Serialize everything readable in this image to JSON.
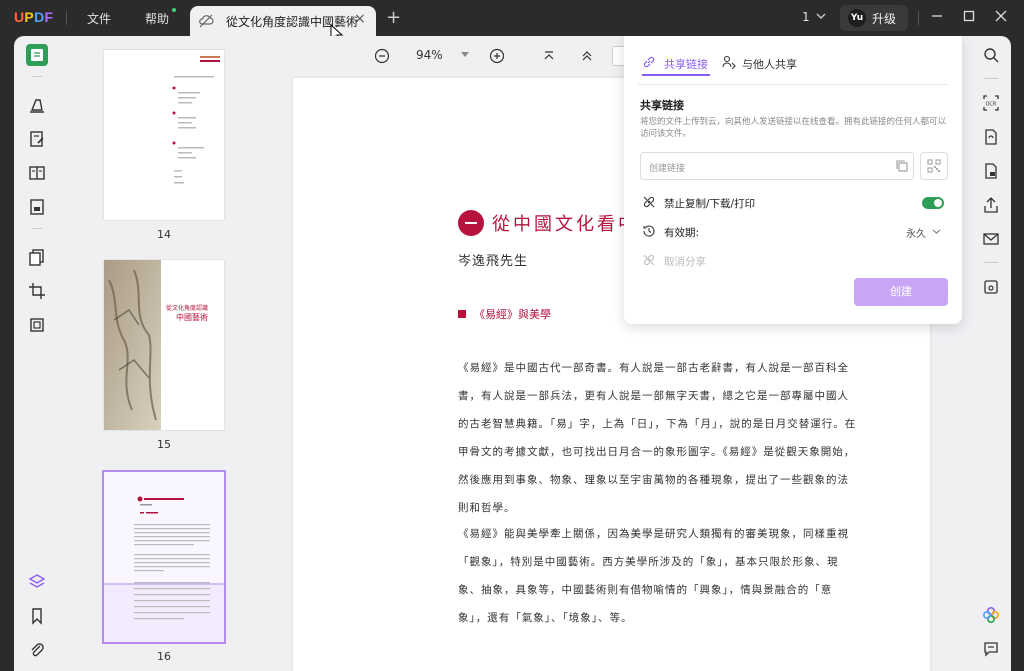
{
  "app": {
    "logo": "UPDF",
    "menu": {
      "file": "文件",
      "help": "帮助"
    },
    "tab": {
      "label": "從文化角度認識中國藝術"
    },
    "page_indicator": "1",
    "user_initials": "Yu",
    "upgrade_label": "升级"
  },
  "toolbar": {
    "zoom": "94%"
  },
  "thumbnails": [
    {
      "page": "14"
    },
    {
      "page": "15",
      "title_line1": "從文化角度認識",
      "title_line2": "中國藝術"
    },
    {
      "page": "16"
    }
  ],
  "document": {
    "chapter_title": "從中國文化看中",
    "author": "岑逸飛先生",
    "section": "《易經》與美學",
    "paragraphs": [
      "《易經》是中國古代一部奇書。有人說是一部古老辭書，有人說是一部百科全書，有人說是一部兵法，更有人說是一部無字天書，總之它是一部專屬中國人的古老智慧典籍。「易」字，上為「日」，下為「月」，說的是日月交替運行。在甲骨文的考據文獻，也可找出日月合一的象形圖字。《易經》是從觀天象開始，然後應用到事象、物象、理象以至宇宙萬物的各種現象，提出了一些觀象的法則和哲學。",
      "《易經》能與美學牽上關係，因為美學是研究人類獨有的審美現象，同樣重視「觀象」，特別是中國藝術。西方美學所涉及的「象」，基本只限於形象、現象、抽象，具象等，中國藝術則有借物喻情的「興象」，情與景融合的「意象」，還有「氣象」、「境象」、等。"
    ]
  },
  "share": {
    "tab_link": "共享链接",
    "tab_others": "与他人共享",
    "heading": "共享链接",
    "description": "将您的文件上传到云，向其他人发送链接以在线查看。拥有此链接的任何人都可以访问该文件。",
    "link_placeholder": "创建链接",
    "disable_copy": "禁止复制/下载/打印",
    "disable_copy_on": true,
    "expiry_label": "有效期:",
    "expiry_value": "永久",
    "cancel_share": "取消分享",
    "create_button": "创建"
  },
  "colors": {
    "accent": "#8a5cf0",
    "brand_green": "#2e9e56",
    "doc_red": "#b5123e"
  }
}
